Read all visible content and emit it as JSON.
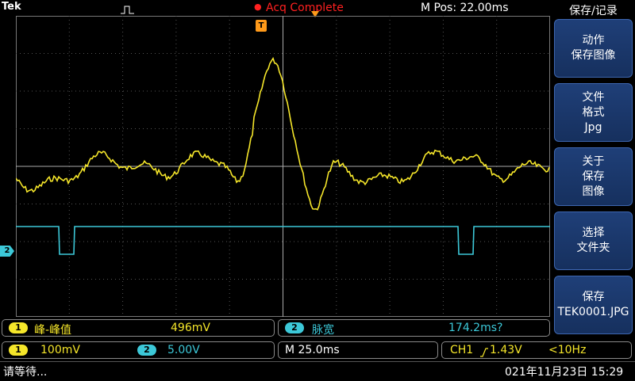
{
  "topbar": {
    "brand": "Tek",
    "trigger_icon": "pulse-trigger-icon",
    "acq_status": "Acq Complete",
    "mpos": "M Pos: 22.00ms"
  },
  "markers": {
    "trigger": "T",
    "ch2_marker": "2"
  },
  "side_menu": {
    "title": "保存/记录",
    "buttons": [
      {
        "lines": [
          "动作",
          "保存图像"
        ]
      },
      {
        "lines": [
          "文件",
          "格式",
          "Jpg"
        ]
      },
      {
        "lines": [
          "关于",
          "保存",
          "图像"
        ]
      },
      {
        "lines": [
          "选择",
          "文件夹"
        ]
      },
      {
        "lines": [
          "保存",
          "TEK0001.JPG"
        ]
      }
    ]
  },
  "measurements": {
    "m1": {
      "channel": "1",
      "name": "峰-峰值",
      "value": "496mV"
    },
    "m2": {
      "channel": "2",
      "name": "脉宽",
      "value": "174.2ms?"
    }
  },
  "settings": {
    "ch1_channel": "1",
    "ch1_scale": "100mV",
    "ch2_channel": "2",
    "ch2_scale": "5.00V",
    "timebase": "M 25.0ms",
    "trigger_source": "CH1",
    "trigger_slope_icon": "rising-edge-icon",
    "trigger_level": "1.43V",
    "trigger_freq": "<10Hz"
  },
  "status": {
    "message": "请等待...",
    "datetime": "021年11月23日 15:29"
  },
  "colors": {
    "ch1": "#f5e62a",
    "ch2": "#3cc8d8",
    "trigger": "#ff9a1a",
    "acq": "#ff2020",
    "menu_button": "#1f3f78"
  }
}
